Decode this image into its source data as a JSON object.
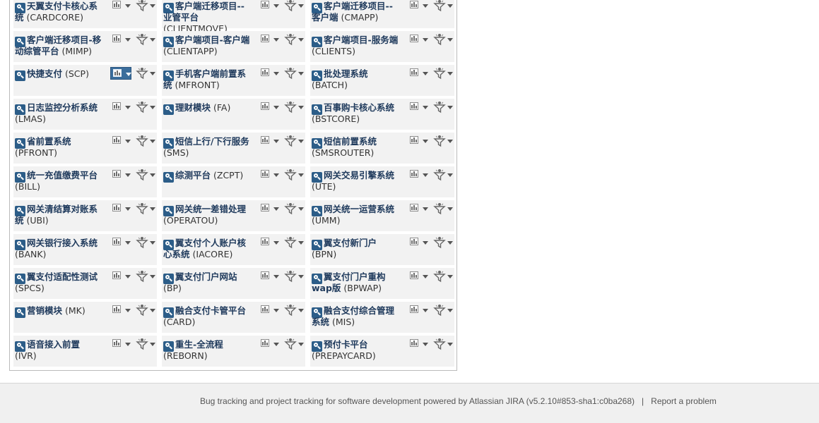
{
  "projects": [
    {
      "name": "天翼支付卡核心系统",
      "code": "(CARDCORE)",
      "lines": [
        "天翼支付卡核心系",
        "统"
      ],
      "split": 1
    },
    {
      "name": "客户端迁移项目--业管平台",
      "code": "(CLIENTMOVE)"
    },
    {
      "name": "客户端迁移项目--客户端",
      "code": "(CMAPP)"
    },
    {
      "name": "客户端迁移项目-移动综管平台",
      "code": "(MIMP)"
    },
    {
      "name": "客户端项目-客户端",
      "code": "(CLIENTAPP)"
    },
    {
      "name": "客户端项目-服务端",
      "code": "(CLIENTS)"
    },
    {
      "name": "快捷支付",
      "code": "(SCP)"
    },
    {
      "name": "手机客户端前置系统",
      "code": "(MFRONT)"
    },
    {
      "name": "批处理系统",
      "code": "(BATCH)"
    },
    {
      "name": "日志监控分析系统",
      "code": "(LMAS)"
    },
    {
      "name": "理财模块",
      "code": "(FA)"
    },
    {
      "name": "百事购卡核心系统",
      "code": "(BSTCORE)"
    },
    {
      "name": "省前置系统",
      "code": "(PFRONT)"
    },
    {
      "name": "短信上行/下行服务",
      "code": "(SMS)"
    },
    {
      "name": "短信前置系统",
      "code": "(SMSROUTER)"
    },
    {
      "name": "统一充值缴费平台",
      "code": "(BILL)"
    },
    {
      "name": "综测平台",
      "code": "(ZCPT)"
    },
    {
      "name": "网关交易引擎系统",
      "code": "(UTE)"
    },
    {
      "name": "网关清结算对账系统",
      "code": "(UBI)"
    },
    {
      "name": "网关统一差错处理",
      "code": "(OPERATOU)"
    },
    {
      "name": "网关统一运营系统",
      "code": "(UMM)"
    },
    {
      "name": "网关银行接入系统",
      "code": "(BANK)"
    },
    {
      "name": "翼支付个人账户核心系统",
      "code": "(IACORE)"
    },
    {
      "name": "翼支付新门户",
      "code": "(BPN)"
    },
    {
      "name": "翼支付适配性测试",
      "code": "(SPCS)"
    },
    {
      "name": "翼支付门户网站",
      "code": "(BP)"
    },
    {
      "name": "翼支付门户重构wap版",
      "code": "(BPWAP)"
    },
    {
      "name": "营销模块",
      "code": "(MK)"
    },
    {
      "name": "融合支付卡管平台",
      "code": "(CARD)"
    },
    {
      "name": "融合支付综合管理系统",
      "code": "(MIS)"
    },
    {
      "name": "语音接入前置",
      "code": "(IVR)"
    },
    {
      "name": "重生-全流程",
      "code": "(REBORN)"
    },
    {
      "name": "预付卡平台",
      "code": "(PREPAYCARD)"
    }
  ],
  "active_chart_index": 6,
  "footer": {
    "text": "Bug tracking and project tracking for software development powered by Atlassian JIRA (v5.2.10#853-sha1:c0ba268)",
    "separator": "|",
    "report_link": "Report a problem"
  }
}
